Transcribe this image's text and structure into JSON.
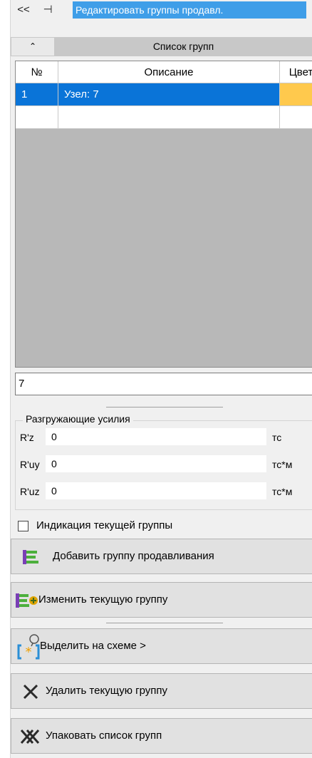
{
  "titlebar": {
    "collapse_label": "<<",
    "pin_label": "⊣",
    "title": "Редактировать группы продавл."
  },
  "section": {
    "collapse_glyph": "⌃",
    "title": "Список групп"
  },
  "grid": {
    "columns": [
      "№",
      "Описание",
      "Цвет"
    ],
    "rows": [
      {
        "num": "1",
        "description": "Узел: 7",
        "color": "#ffc94d",
        "selected": true
      }
    ]
  },
  "description_field": {
    "value": "7"
  },
  "unloading": {
    "title": "Разгружающие усилия",
    "fields": [
      {
        "label": "R'z",
        "value": "0",
        "unit": "тс"
      },
      {
        "label": "R'uy",
        "value": "0",
        "unit": "тс*м"
      },
      {
        "label": "R'uz",
        "value": "0",
        "unit": "тс*м"
      }
    ]
  },
  "indicate_checkbox": {
    "label": "Индикация текущей группы",
    "checked": false
  },
  "buttons": {
    "add_group": "Добавить группу продавливания",
    "edit_group": "Изменить текущую группу",
    "select_on_scheme": "Выделить на схеме >",
    "delete_group": "Удалить текущую группу",
    "pack_list": "Упаковать список групп"
  },
  "icons": {
    "add_group": "colored-list-icon",
    "edit_group": "colored-list-plus-icon",
    "select_on_scheme": "bracket-star-icon",
    "delete_group": "x-cross-icon",
    "pack_list": "double-x-cross-icon"
  }
}
